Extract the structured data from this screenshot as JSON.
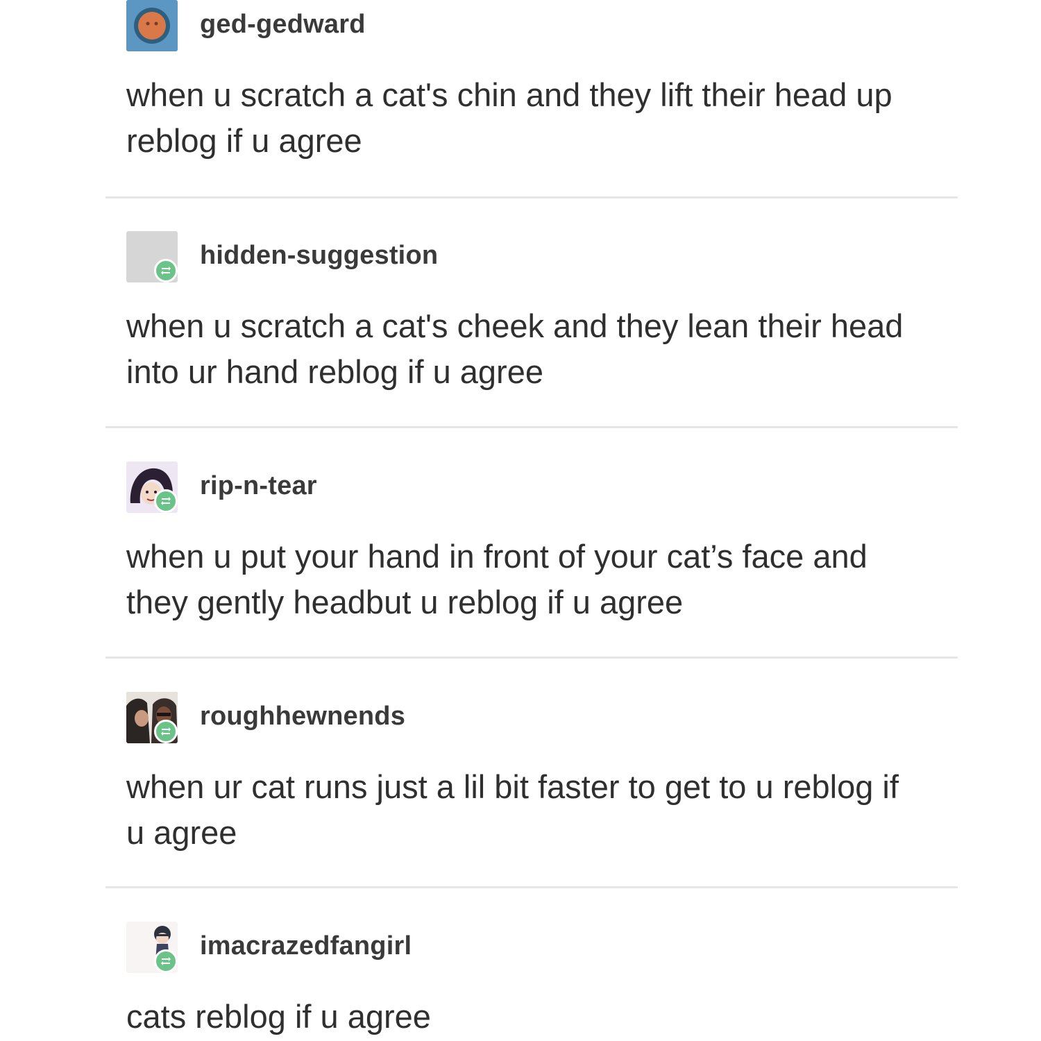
{
  "posts": [
    {
      "username": "ged-gedward",
      "avatar_icon": "orange-circle-avatar",
      "reblog_badge": false,
      "lines": [
        "when u scratch a cat's chin and they lift their head up",
        "reblog if u agree"
      ]
    },
    {
      "username": "hidden-suggestion",
      "avatar_icon": "gray-placeholder-avatar",
      "reblog_badge": true,
      "lines": [
        "when u scratch a cat's cheek and they lean their head",
        "into ur hand reblog if u agree"
      ]
    },
    {
      "username": "rip-n-tear",
      "avatar_icon": "cartoon-character-avatar",
      "reblog_badge": true,
      "lines": [
        "when u put your hand in front of your cat’s face and",
        "they gently headbut u reblog if u agree"
      ]
    },
    {
      "username": "roughhewnends",
      "avatar_icon": "photo-people-avatar",
      "reblog_badge": true,
      "lines": [
        "when ur cat runs just a lil bit faster to get to u reblog if",
        "u agree"
      ]
    },
    {
      "username": "imacrazedfangirl",
      "avatar_icon": "anime-character-avatar",
      "reblog_badge": true,
      "lines": [
        "cats reblog if u agree"
      ]
    }
  ],
  "colors": {
    "reblog_badge": "#6cc38a",
    "divider": "#e6e6e6",
    "username": "#3a3a3a",
    "body_text": "#2f2f2f"
  }
}
